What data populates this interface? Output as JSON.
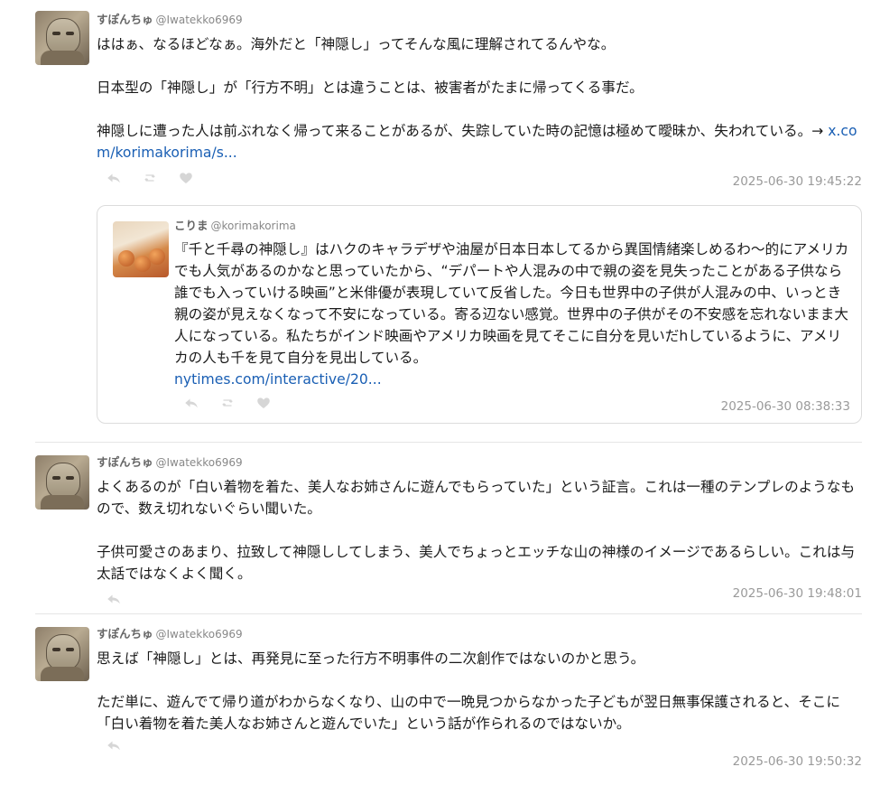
{
  "posts": [
    {
      "name": "すぽんちゅ",
      "handle": "@Iwatekko6969",
      "paragraphs": [
        "ははぁ、なるほどなぁ。海外だと「神隠し」ってそんな風に理解されてるんやな。",
        "日本型の「神隠し」が「行方不明」とは違うことは、被害者がたまに帰ってくる事だ。",
        "神隠しに遭った人は前ぶれなく帰って来ることがあるが、失踪していた時の記憶は極めて曖昧か、失われている。→ "
      ],
      "link": "x.com/korimakorima/s...",
      "timestamp": "2025-06-30 19:45:22"
    },
    {
      "name": "すぽんちゅ",
      "handle": "@Iwatekko6969",
      "paragraphs": [
        "よくあるのが「白い着物を着た、美人なお姉さんに遊んでもらっていた」という証言。これは一種のテンプレのようなもので、数え切れないぐらい聞いた。",
        "子供可愛さのあまり、拉致して神隠ししてしまう、美人でちょっとエッチな山の神様のイメージであるらしい。これは与太話ではなくよく聞く。"
      ],
      "timestamp": "2025-06-30 19:48:01"
    },
    {
      "name": "すぽんちゅ",
      "handle": "@Iwatekko6969",
      "paragraphs": [
        "思えば「神隠し」とは、再発見に至った行方不明事件の二次創作ではないのかと思う。",
        "ただ単に、遊んでて帰り道がわからなくなり、山の中で一晩見つからなかった子どもが翌日無事保護されると、そこに「白い着物を着た美人なお姉さんと遊んでいた」という話が作られるのではないか。"
      ],
      "timestamp": "2025-06-30 19:50:32"
    }
  ],
  "quote": {
    "name": "こりま",
    "handle": "@korimakorima",
    "text": "『千と千尋の神隠し』はハクのキャラデザや油屋が日本日本してるから異国情緒楽しめるわ〜的にアメリカでも人気があるのかなと思っていたから、“デパートや人混みの中で親の姿を見失ったことがある子供なら誰でも入っていける映画”と米俳優が表現していて反省した。今日も世界中の子供が人混みの中、いっとき親の姿が見えなくなって不安になっている。寄る辺ない感覚。世界中の子供がその不安感を忘れないまま大人になっている。私たちがインド映画やアメリカ映画を見てそこに自分を見いだhしているように、アメリカの人も千を見て自分を見出している。",
    "link": "nytimes.com/interactive/20...",
    "timestamp": "2025-06-30 08:38:33"
  },
  "icons": {
    "reply": "reply-icon",
    "repost": "repost-icon",
    "like": "heart-icon"
  },
  "colors": {
    "link": "#1a5fb4",
    "muted": "#9a9a9a",
    "icon": "#d6d6d6"
  }
}
